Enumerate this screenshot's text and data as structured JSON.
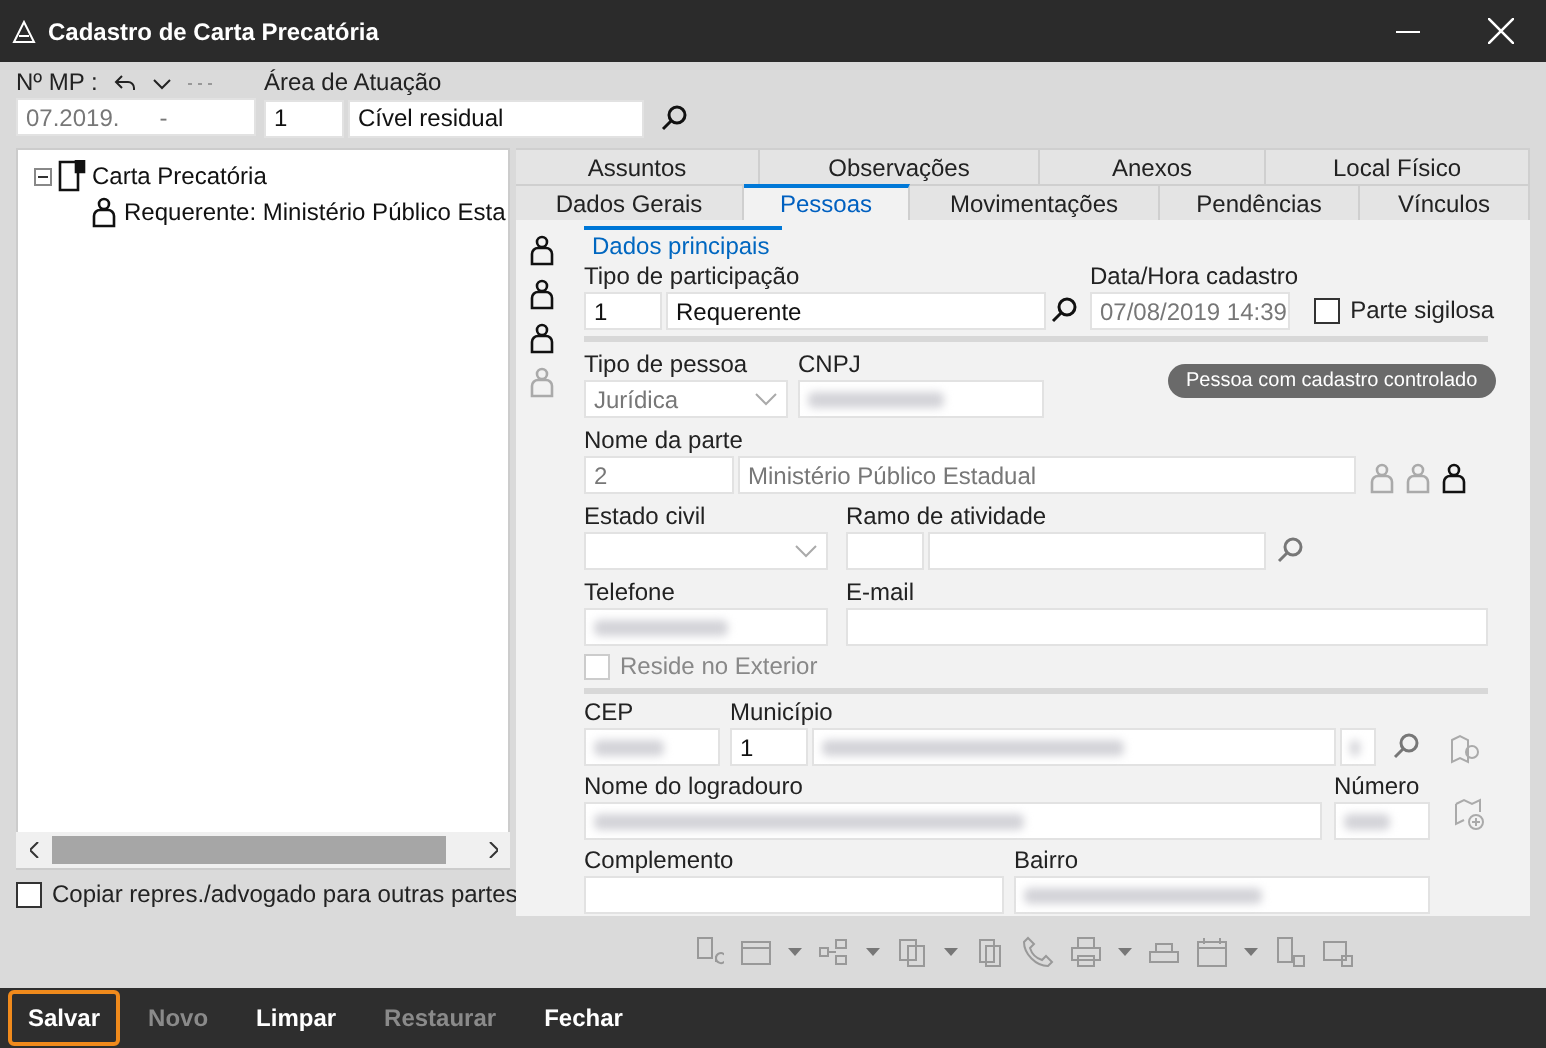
{
  "window": {
    "title": "Cadastro de Carta Precatória"
  },
  "header": {
    "mp_label": "Nº MP :",
    "mp_value": "07.2019.      -",
    "area_label": "Área de Atuação",
    "area_code": "1",
    "area_name": "Cível residual"
  },
  "tree": [
    {
      "label": "Carta Precatória",
      "expanded": true,
      "children": [
        {
          "label": "Requerente: Ministério Público Esta"
        }
      ]
    }
  ],
  "copy_option": {
    "label": "Copiar repres./advogado para outras partes",
    "checked": false
  },
  "tabs_top": [
    {
      "label": "Assuntos",
      "selected": false
    },
    {
      "label": "Observações",
      "selected": false
    },
    {
      "label": "Anexos",
      "selected": false
    },
    {
      "label": "Local Físico",
      "selected": false
    }
  ],
  "tabs_bottom": [
    {
      "label": "Dados Gerais",
      "selected": false
    },
    {
      "label": "Pessoas",
      "selected": true
    },
    {
      "label": "Movimentações",
      "selected": false
    },
    {
      "label": "Pendências",
      "selected": false
    },
    {
      "label": "Vínculos",
      "selected": false
    }
  ],
  "subtabs": [
    {
      "label": "Dados principais",
      "selected": true
    }
  ],
  "form": {
    "participacao": {
      "label": "Tipo de participação",
      "code": "1",
      "value": "Requerente"
    },
    "data_hora": {
      "label": "Data/Hora cadastro",
      "value": "07/08/2019 14:39",
      "disabled": true
    },
    "parte_sigilosa": {
      "label": "Parte sigilosa",
      "checked": false
    },
    "tipo_pessoa": {
      "label": "Tipo de pessoa",
      "value": "Jurídica",
      "disabled": true
    },
    "cnpj": {
      "label": "CNPJ",
      "redacted": true
    },
    "badge": "Pessoa com cadastro controlado",
    "nome": {
      "label": "Nome da parte",
      "code": "2",
      "value": "Ministério Público Estadual",
      "disabled": true
    },
    "estado_civil": {
      "label": "Estado civil"
    },
    "ramo": {
      "label": "Ramo de atividade"
    },
    "telefone": {
      "label": "Telefone",
      "redacted": true
    },
    "email": {
      "label": "E-mail"
    },
    "reside_exterior": {
      "label": "Reside no Exterior",
      "checked": false,
      "disabled": true
    },
    "cep": {
      "label": "CEP",
      "redacted": true
    },
    "municipio": {
      "label": "Município",
      "code": "1",
      "redacted": true
    },
    "logradouro": {
      "label": "Nome do logradouro",
      "redacted": true
    },
    "numero": {
      "label": "Número",
      "redacted": true
    },
    "complemento": {
      "label": "Complemento"
    },
    "bairro": {
      "label": "Bairro",
      "redacted": true
    }
  },
  "actions": [
    {
      "label": "Salvar",
      "disabled": false,
      "focused": true
    },
    {
      "label": "Novo",
      "disabled": true,
      "focused": false
    },
    {
      "label": "Limpar",
      "disabled": false,
      "focused": false
    },
    {
      "label": "Restaurar",
      "disabled": true,
      "focused": false
    },
    {
      "label": "Fechar",
      "disabled": false,
      "focused": false
    }
  ]
}
